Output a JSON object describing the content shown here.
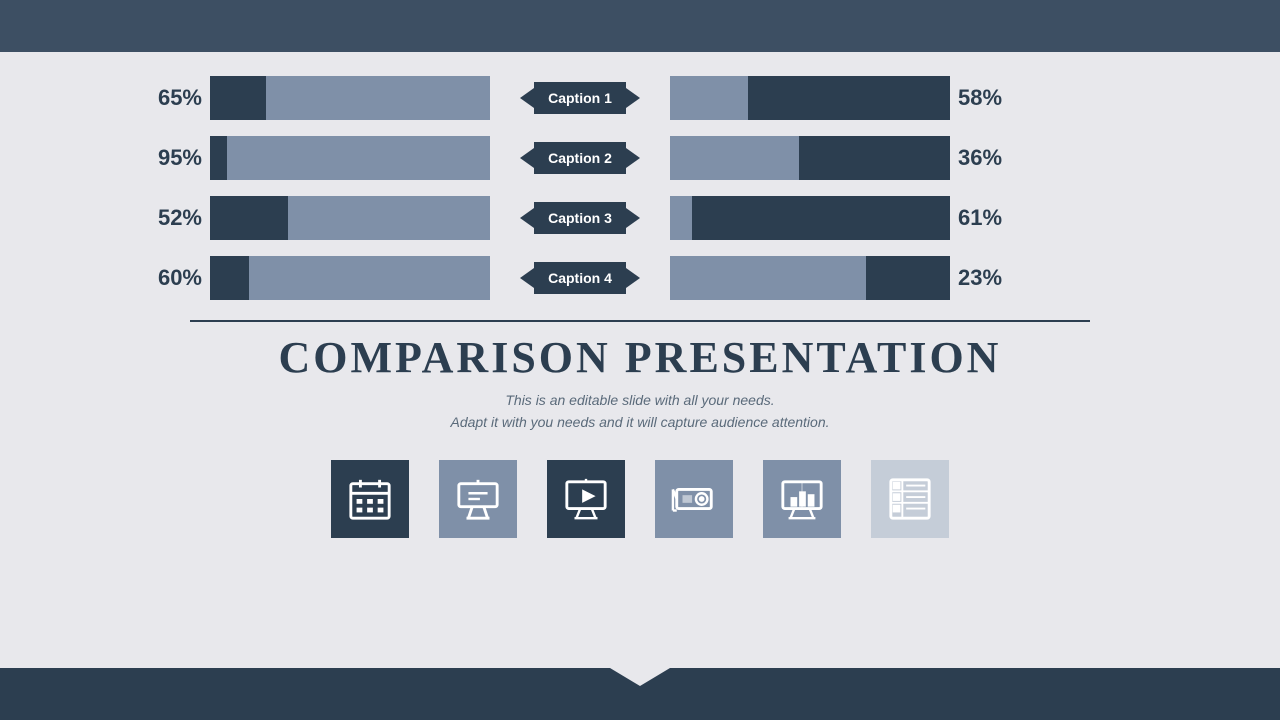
{
  "topBar": {},
  "bottomBar": {},
  "charts": {
    "rows": [
      {
        "leftPercent": "65%",
        "leftFillPercent": 20,
        "caption": "Caption 1",
        "rightFillPercent": 72,
        "rightPercent": "58%"
      },
      {
        "leftPercent": "95%",
        "leftFillPercent": 6,
        "caption": "Caption 2",
        "rightFillPercent": 54,
        "rightPercent": "36%"
      },
      {
        "leftPercent": "52%",
        "leftFillPercent": 28,
        "caption": "Caption 3",
        "rightFillPercent": 92,
        "rightPercent": "61%"
      },
      {
        "leftPercent": "60%",
        "leftFillPercent": 14,
        "caption": "Caption 4",
        "rightFillPercent": 30,
        "rightPercent": "23%"
      }
    ]
  },
  "title": {
    "main": "COMPARISON PRESENTATION",
    "line1": "This is an editable slide with all your needs.",
    "line2": "Adapt it with you needs and it will capture audience attention."
  },
  "icons": [
    {
      "name": "calendar-icon",
      "label": "Calendar"
    },
    {
      "name": "billboard-icon",
      "label": "Billboard"
    },
    {
      "name": "presentation-play-icon",
      "label": "Presentation Play"
    },
    {
      "name": "projector-icon",
      "label": "Projector"
    },
    {
      "name": "presentation-chart-icon",
      "label": "Presentation Chart"
    },
    {
      "name": "list-icon",
      "label": "List"
    }
  ]
}
